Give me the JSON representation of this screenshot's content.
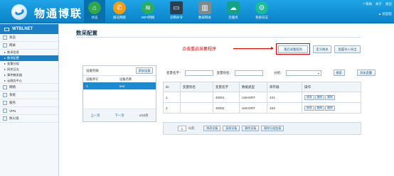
{
  "header": {
    "brand": "物通博联",
    "nav": [
      {
        "label": "状态",
        "icon": "home-icon",
        "color": "#2fa84a"
      },
      {
        "label": "拨号网络",
        "icon": "dialup-icon",
        "color": "#f39c12"
      },
      {
        "label": "WIFI网络",
        "icon": "wifi-icon",
        "color": "#27ae60"
      },
      {
        "label": "诊断命令",
        "icon": "terminal-icon",
        "color": "#2c3e50"
      },
      {
        "label": "数采网关",
        "icon": "gateway-icon",
        "color": "#7f8c8d"
      },
      {
        "label": "云服务",
        "icon": "cloud-icon",
        "color": "#16a085"
      },
      {
        "label": "系统日志",
        "icon": "log-icon",
        "color": "#1abc9c"
      }
    ],
    "help": "? 帮助",
    "about": "关于",
    "logout": "退出",
    "user": "▲ 欢迎您"
  },
  "sidebar": {
    "title": "WTBLNET",
    "groups": [
      {
        "label": "状态"
      },
      {
        "label": "网关"
      }
    ],
    "subitems": [
      {
        "label": "数采信息"
      },
      {
        "label": "数采配置"
      },
      {
        "label": "变量分组"
      },
      {
        "label": "网关日志"
      },
      {
        "label": "事件触发器"
      },
      {
        "label": "云服务中心"
      }
    ],
    "groups2": [
      {
        "label": "网络"
      },
      {
        "label": "系统"
      },
      {
        "label": "服务"
      },
      {
        "label": "VPN"
      },
      {
        "label": "防火墙"
      }
    ]
  },
  "main": {
    "title": "数采配置",
    "annotation": "点击重启采集程序",
    "buttons": {
      "restart": "重启采集程序",
      "define_gateway": "定义网关",
      "export": "配置导入导出"
    }
  },
  "device_panel": {
    "title": "设备列表",
    "add_button": "添加设备",
    "col_index": "设备序号",
    "col_name": "设备名称",
    "row_index": "1",
    "row_name": "test",
    "prev": "上一页",
    "next": "下一页",
    "page_info": "1/10页"
  },
  "filters": {
    "var_name_label": "变量名字：",
    "var_alias_label": "变量别名：",
    "group_label": "分组：",
    "search": "搜索",
    "add_var": "添加变量"
  },
  "table": {
    "headers": [
      "ID",
      "变量别名",
      "变量名字",
      "数据类型",
      "寄存器",
      "操作"
    ],
    "rows": [
      {
        "id": "1",
        "alias": "",
        "name": "40001",
        "type": "USHORT",
        "reg": "4X1"
      },
      {
        "id": "2",
        "alias": "",
        "name": "40002",
        "type": "USHORT",
        "reg": "4X2"
      }
    ],
    "ops": [
      "修改",
      "复制",
      "删除"
    ]
  },
  "bottom": {
    "page": "1",
    "page_suffix": "/1页",
    "modify_device": "修改设备",
    "copy_device": "复制设备",
    "delete_device": "删除设备",
    "delete_group_vars": "删除分组变量"
  }
}
